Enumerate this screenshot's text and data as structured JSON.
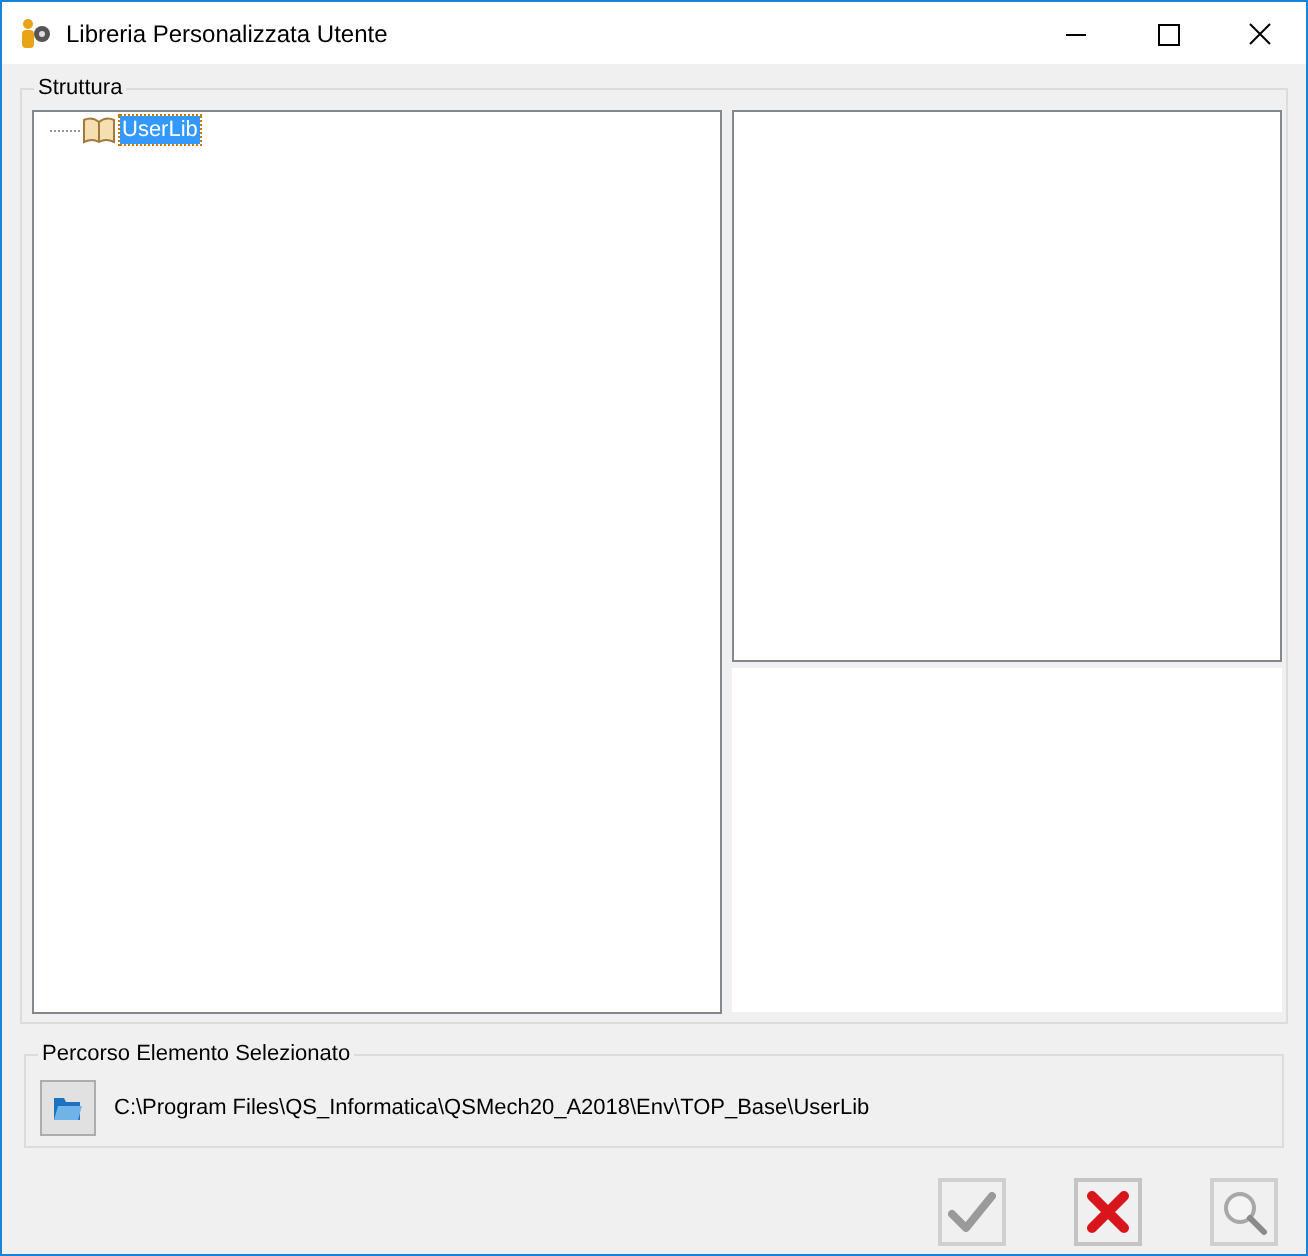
{
  "window": {
    "title": "Libreria Personalizzata Utente"
  },
  "structure": {
    "label": "Struttura",
    "tree": [
      {
        "label": "UserLib",
        "selected": true
      }
    ]
  },
  "selected_path": {
    "label": "Percorso Elemento Selezionato",
    "path": "C:\\Program Files\\QS_Informatica\\QSMech20_A2018\\Env\\TOP_Base\\UserLib"
  },
  "buttons": [
    {
      "kind": "confirm",
      "disabled": true
    },
    {
      "kind": "cancel",
      "disabled": false
    },
    {
      "kind": "preview",
      "disabled": true
    }
  ]
}
